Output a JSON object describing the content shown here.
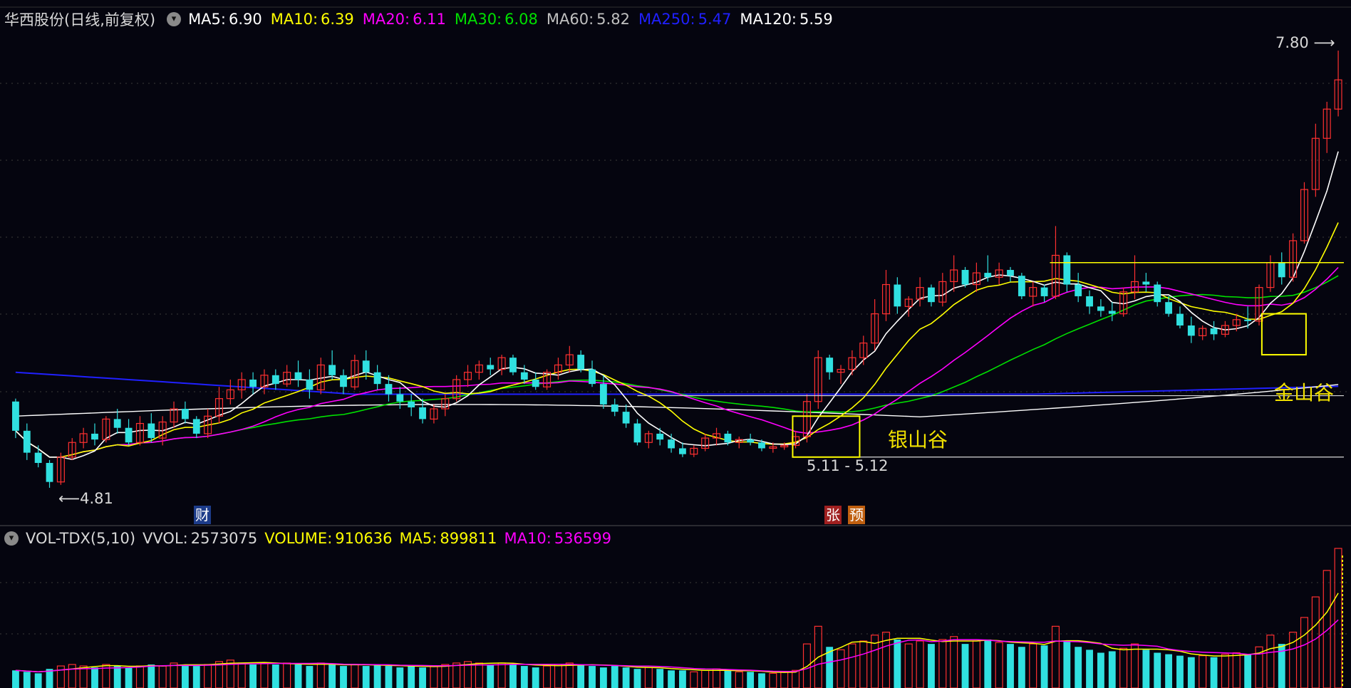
{
  "colors": {
    "bg": "#05050f",
    "up": "#ff3030",
    "down": "#30e0e0",
    "ma5": "#ffffff",
    "ma10": "#ffff00",
    "ma20": "#ff00ff",
    "ma30": "#00e000",
    "ma60": "#c0c0c0",
    "ma250": "#2020ff",
    "ma120": "#ffffff",
    "annot": "#ffff00",
    "grid": "#3a3a3a"
  },
  "header": {
    "title": "华西股份(日线,前复权)",
    "toggle_icon": "chevron-down-icon",
    "ma": [
      {
        "name": "MA5:",
        "value": "6.90",
        "color": "#ffffff"
      },
      {
        "name": "MA10:",
        "value": "6.39",
        "color": "#ffff00"
      },
      {
        "name": "MA20:",
        "value": "6.11",
        "color": "#ff00ff"
      },
      {
        "name": "MA30:",
        "value": "6.08",
        "color": "#00e000"
      },
      {
        "name": "MA60:",
        "value": "5.82",
        "color": "#c0c0c0"
      },
      {
        "name": "MA250:",
        "value": "5.47",
        "color": "#2020ff"
      },
      {
        "name": "MA120:",
        "value": "5.59",
        "color": "#ffffff"
      }
    ]
  },
  "annotations": {
    "high_label": "7.80",
    "low_label": "4.81",
    "range_label": "5.11 - 5.12",
    "silver_valley": "银山谷",
    "gold_valley": "金山谷",
    "badge_cai": "财",
    "badge_zhang": "张",
    "badge_yu": "预"
  },
  "volume_header": {
    "title": "VOL-TDX(5,10)",
    "vvol_name": "VVOL:",
    "vvol_value": "2573075",
    "volume_name": "VOLUME:",
    "volume_value": "910636",
    "ma5_name": "MA5:",
    "ma5_value": "899811",
    "ma10_name": "MA10:",
    "ma10_value": "536599"
  },
  "chart_data": {
    "type": "candlestick",
    "ylim": [
      4.6,
      8.0
    ],
    "ohlc": [
      [
        5.4,
        5.42,
        5.15,
        5.2
      ],
      [
        5.2,
        5.25,
        5.0,
        5.05
      ],
      [
        5.05,
        5.1,
        4.95,
        4.98
      ],
      [
        4.98,
        5.0,
        4.81,
        4.85
      ],
      [
        4.85,
        5.05,
        4.83,
        5.02
      ],
      [
        5.02,
        5.15,
        5.0,
        5.12
      ],
      [
        5.12,
        5.22,
        5.08,
        5.18
      ],
      [
        5.18,
        5.25,
        5.1,
        5.14
      ],
      [
        5.14,
        5.3,
        5.12,
        5.28
      ],
      [
        5.28,
        5.35,
        5.18,
        5.22
      ],
      [
        5.22,
        5.28,
        5.1,
        5.12
      ],
      [
        5.12,
        5.3,
        5.1,
        5.25
      ],
      [
        5.25,
        5.32,
        5.12,
        5.15
      ],
      [
        5.15,
        5.3,
        5.1,
        5.26
      ],
      [
        5.26,
        5.4,
        5.22,
        5.35
      ],
      [
        5.35,
        5.4,
        5.25,
        5.28
      ],
      [
        5.28,
        5.3,
        5.15,
        5.18
      ],
      [
        5.18,
        5.35,
        5.15,
        5.3
      ],
      [
        5.3,
        5.5,
        5.25,
        5.42
      ],
      [
        5.42,
        5.55,
        5.38,
        5.48
      ],
      [
        5.48,
        5.6,
        5.42,
        5.55
      ],
      [
        5.55,
        5.6,
        5.45,
        5.5
      ],
      [
        5.5,
        5.62,
        5.45,
        5.58
      ],
      [
        5.58,
        5.62,
        5.48,
        5.52
      ],
      [
        5.52,
        5.65,
        5.5,
        5.6
      ],
      [
        5.6,
        5.68,
        5.5,
        5.55
      ],
      [
        5.55,
        5.62,
        5.42,
        5.48
      ],
      [
        5.48,
        5.7,
        5.45,
        5.65
      ],
      [
        5.65,
        5.75,
        5.55,
        5.58
      ],
      [
        5.58,
        5.62,
        5.45,
        5.5
      ],
      [
        5.5,
        5.72,
        5.48,
        5.68
      ],
      [
        5.68,
        5.75,
        5.55,
        5.6
      ],
      [
        5.6,
        5.65,
        5.48,
        5.52
      ],
      [
        5.52,
        5.58,
        5.4,
        5.45
      ],
      [
        5.45,
        5.5,
        5.35,
        5.4
      ],
      [
        5.4,
        5.45,
        5.3,
        5.36
      ],
      [
        5.36,
        5.42,
        5.25,
        5.28
      ],
      [
        5.28,
        5.38,
        5.25,
        5.35
      ],
      [
        5.35,
        5.45,
        5.3,
        5.42
      ],
      [
        5.42,
        5.58,
        5.4,
        5.55
      ],
      [
        5.55,
        5.65,
        5.5,
        5.6
      ],
      [
        5.6,
        5.68,
        5.55,
        5.65
      ],
      [
        5.65,
        5.7,
        5.58,
        5.62
      ],
      [
        5.62,
        5.72,
        5.58,
        5.7
      ],
      [
        5.7,
        5.72,
        5.58,
        5.6
      ],
      [
        5.6,
        5.65,
        5.52,
        5.55
      ],
      [
        5.55,
        5.6,
        5.48,
        5.5
      ],
      [
        5.5,
        5.62,
        5.48,
        5.6
      ],
      [
        5.6,
        5.7,
        5.55,
        5.65
      ],
      [
        5.65,
        5.78,
        5.6,
        5.72
      ],
      [
        5.72,
        5.75,
        5.6,
        5.62
      ],
      [
        5.62,
        5.68,
        5.5,
        5.52
      ],
      [
        5.52,
        5.58,
        5.35,
        5.38
      ],
      [
        5.38,
        5.42,
        5.3,
        5.33
      ],
      [
        5.33,
        5.38,
        5.22,
        5.25
      ],
      [
        5.25,
        5.28,
        5.1,
        5.12
      ],
      [
        5.12,
        5.2,
        5.08,
        5.18
      ],
      [
        5.18,
        5.22,
        5.1,
        5.14
      ],
      [
        5.14,
        5.18,
        5.05,
        5.08
      ],
      [
        5.08,
        5.12,
        5.02,
        5.04
      ],
      [
        5.04,
        5.1,
        5.02,
        5.08
      ],
      [
        5.08,
        5.18,
        5.06,
        5.15
      ],
      [
        5.15,
        5.22,
        5.1,
        5.18
      ],
      [
        5.18,
        5.2,
        5.1,
        5.12
      ],
      [
        5.12,
        5.16,
        5.08,
        5.14
      ],
      [
        5.14,
        5.18,
        5.1,
        5.12
      ],
      [
        5.12,
        5.14,
        5.06,
        5.08
      ],
      [
        5.08,
        5.12,
        5.05,
        5.09
      ],
      [
        5.09,
        5.12,
        5.07,
        5.1
      ],
      [
        5.1,
        5.2,
        5.08,
        5.16
      ],
      [
        5.16,
        5.45,
        5.12,
        5.4
      ],
      [
        5.4,
        5.75,
        5.35,
        5.7
      ],
      [
        5.7,
        5.72,
        5.55,
        5.6
      ],
      [
        5.6,
        5.65,
        5.52,
        5.62
      ],
      [
        5.62,
        5.75,
        5.58,
        5.7
      ],
      [
        5.7,
        5.85,
        5.65,
        5.8
      ],
      [
        5.8,
        6.1,
        5.75,
        6.0
      ],
      [
        6.0,
        6.3,
        5.95,
        6.2
      ],
      [
        6.2,
        6.25,
        6.0,
        6.05
      ],
      [
        6.05,
        6.12,
        5.98,
        6.1
      ],
      [
        6.1,
        6.25,
        6.05,
        6.18
      ],
      [
        6.18,
        6.2,
        6.05,
        6.08
      ],
      [
        6.08,
        6.28,
        6.05,
        6.22
      ],
      [
        6.22,
        6.4,
        6.15,
        6.3
      ],
      [
        6.3,
        6.32,
        6.18,
        6.2
      ],
      [
        6.2,
        6.35,
        6.15,
        6.28
      ],
      [
        6.28,
        6.4,
        6.22,
        6.25
      ],
      [
        6.25,
        6.35,
        6.2,
        6.3
      ],
      [
        6.3,
        6.32,
        6.22,
        6.26
      ],
      [
        6.26,
        6.28,
        6.1,
        6.12
      ],
      [
        6.12,
        6.22,
        6.05,
        6.18
      ],
      [
        6.18,
        6.2,
        6.08,
        6.12
      ],
      [
        6.12,
        6.6,
        6.1,
        6.4
      ],
      [
        6.4,
        6.42,
        6.15,
        6.2
      ],
      [
        6.2,
        6.28,
        6.08,
        6.12
      ],
      [
        6.12,
        6.16,
        6.0,
        6.05
      ],
      [
        6.05,
        6.1,
        5.98,
        6.02
      ],
      [
        6.02,
        6.08,
        5.95,
        6.0
      ],
      [
        6.0,
        6.18,
        5.98,
        6.15
      ],
      [
        6.15,
        6.4,
        6.1,
        6.22
      ],
      [
        6.22,
        6.28,
        6.15,
        6.2
      ],
      [
        6.2,
        6.22,
        6.05,
        6.08
      ],
      [
        6.08,
        6.12,
        5.98,
        6.0
      ],
      [
        6.0,
        6.05,
        5.9,
        5.92
      ],
      [
        5.92,
        5.98,
        5.8,
        5.85
      ],
      [
        5.85,
        5.92,
        5.82,
        5.9
      ],
      [
        5.9,
        5.95,
        5.82,
        5.86
      ],
      [
        5.86,
        5.95,
        5.84,
        5.92
      ],
      [
        5.92,
        6.0,
        5.88,
        5.96
      ],
      [
        5.96,
        6.05,
        5.9,
        5.95
      ],
      [
        5.95,
        6.2,
        5.92,
        6.18
      ],
      [
        6.18,
        6.4,
        6.15,
        6.35
      ],
      [
        6.35,
        6.42,
        6.2,
        6.25
      ],
      [
        6.25,
        6.55,
        6.22,
        6.5
      ],
      [
        6.5,
        6.9,
        6.48,
        6.85
      ],
      [
        6.85,
        7.3,
        6.8,
        7.2
      ],
      [
        7.2,
        7.45,
        7.1,
        7.4
      ],
      [
        7.4,
        7.8,
        7.35,
        7.6
      ]
    ],
    "volume": [
      120,
      110,
      100,
      130,
      150,
      160,
      150,
      140,
      160,
      150,
      140,
      150,
      160,
      150,
      170,
      160,
      150,
      160,
      180,
      190,
      170,
      160,
      170,
      160,
      170,
      160,
      150,
      170,
      160,
      150,
      160,
      150,
      160,
      150,
      140,
      150,
      140,
      150,
      160,
      170,
      180,
      170,
      160,
      170,
      160,
      150,
      140,
      150,
      160,
      170,
      160,
      150,
      140,
      150,
      140,
      130,
      140,
      130,
      120,
      120,
      110,
      120,
      130,
      120,
      110,
      110,
      100,
      100,
      110,
      120,
      300,
      420,
      280,
      260,
      300,
      320,
      360,
      380,
      330,
      300,
      320,
      300,
      330,
      350,
      300,
      320,
      330,
      310,
      300,
      280,
      300,
      290,
      420,
      320,
      280,
      260,
      240,
      250,
      270,
      300,
      260,
      240,
      230,
      220,
      210,
      220,
      210,
      230,
      240,
      230,
      280,
      360,
      300,
      380,
      480,
      620,
      800,
      950
    ]
  }
}
